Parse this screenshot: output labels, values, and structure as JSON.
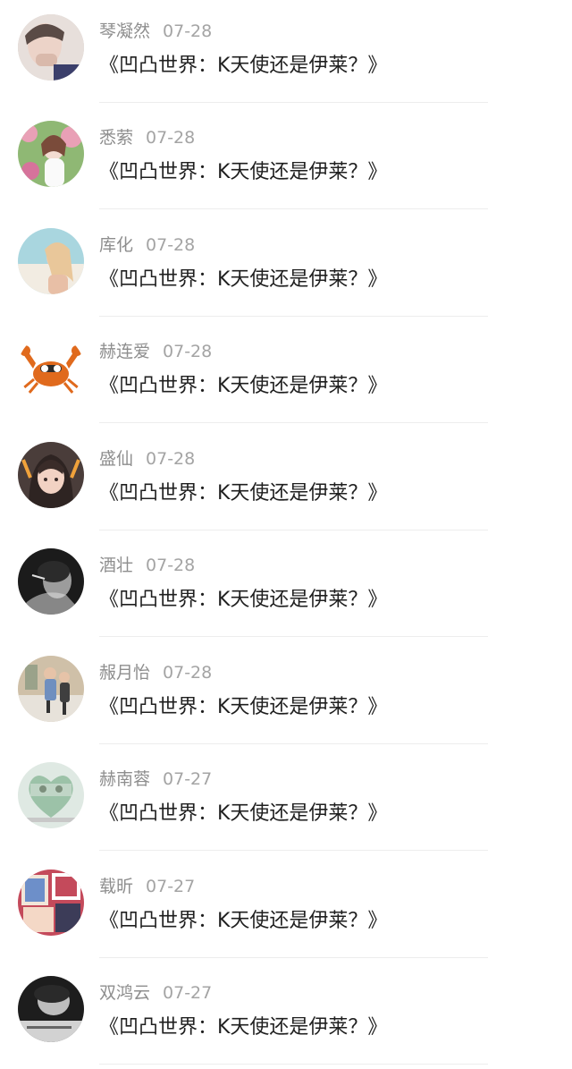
{
  "comments": [
    {
      "name": "琴凝然",
      "date": "07-28",
      "text": "《凹凸世界：K天使还是伊莱？》",
      "avatar": {
        "icon": "avatar-photo-woman-hand-over-face",
        "colors": [
          "#cfc6c2",
          "#e7dfdb",
          "#5a4b46"
        ]
      }
    },
    {
      "name": "悉萦",
      "date": "07-28",
      "text": "《凹凸世界：K天使还是伊莱？》",
      "avatar": {
        "icon": "avatar-photo-girl-with-flowers",
        "colors": [
          "#8fb874",
          "#e9a0b6",
          "#f3dcd1"
        ]
      }
    },
    {
      "name": "库化",
      "date": "07-28",
      "text": "《凹凸世界：K天使还是伊莱？》",
      "avatar": {
        "icon": "avatar-photo-blonde-woman-beach",
        "colors": [
          "#a9d6df",
          "#e9c79a",
          "#f2ece2"
        ]
      }
    },
    {
      "name": "赫连爱",
      "date": "07-28",
      "text": "《凹凸世界：K天使还是伊莱？》",
      "avatar": {
        "icon": "avatar-crab-cartoon",
        "colors": [
          "#ffffff",
          "#e06a1d",
          "#2c2c2c"
        ]
      }
    },
    {
      "name": "盛仙",
      "date": "07-28",
      "text": "《凹凸世界：K天使还是伊莱？》",
      "avatar": {
        "icon": "avatar-anime-girl",
        "colors": [
          "#4a3d3a",
          "#f2d2c3",
          "#f0a23b"
        ]
      }
    },
    {
      "name": "酒壮",
      "date": "07-28",
      "text": "《凹凸世界：K天使还是伊莱？》",
      "avatar": {
        "icon": "avatar-photo-black-and-white-portrait",
        "colors": [
          "#1b1b1b",
          "#9c9c9c",
          "#e0e0e0"
        ]
      }
    },
    {
      "name": "赧月怡",
      "date": "07-28",
      "text": "《凹凸世界：K天使还是伊莱？》",
      "avatar": {
        "icon": "avatar-photo-couple-street",
        "colors": [
          "#cfc0a8",
          "#6f8fbf",
          "#e7e2da"
        ]
      }
    },
    {
      "name": "赫南蓉",
      "date": "07-27",
      "text": "《凹凸世界：K天使还是伊莱？》",
      "avatar": {
        "icon": "avatar-heart-shaped-photo",
        "colors": [
          "#dfe9e3",
          "#9cc2a8",
          "#f4f4f4"
        ]
      }
    },
    {
      "name": "载昕",
      "date": "07-27",
      "text": "《凹凸世界：K天使还是伊莱？》",
      "avatar": {
        "icon": "avatar-photo-collage",
        "colors": [
          "#c44a5b",
          "#6d8fc9",
          "#f1e6d9"
        ]
      }
    },
    {
      "name": "双鸿云",
      "date": "07-27",
      "text": "《凹凸世界：K天使还是伊莱？》",
      "avatar": {
        "icon": "avatar-photo-dark-portrait",
        "colors": [
          "#1d1d1d",
          "#bdbdbd",
          "#f2f2f2"
        ]
      }
    }
  ]
}
